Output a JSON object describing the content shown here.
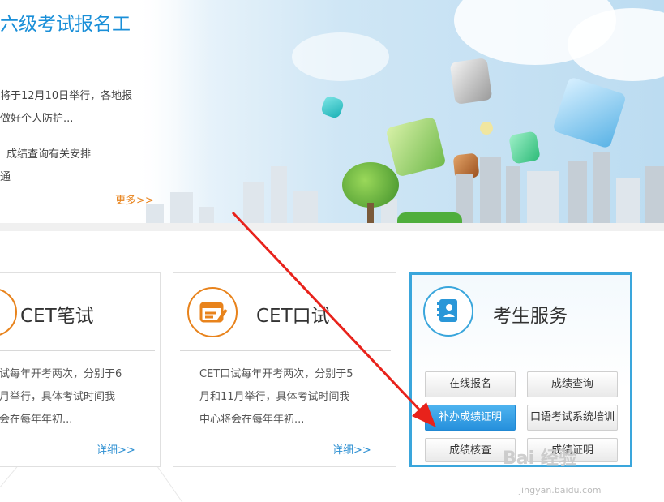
{
  "banner": {
    "title": "六级考试报名工",
    "news": [
      "将于12月10日举行，各地报",
      "做好个人防护...",
      "成绩查询有关安排",
      "通"
    ],
    "more_label": "更多>>"
  },
  "cards": [
    {
      "title": "CET笔试",
      "body": [
        "试每年开考两次，分别于6",
        "月举行，具体考试时间我",
        "会在每年年初..."
      ],
      "detail_label": "详细>>"
    },
    {
      "title": "CET口试",
      "body": [
        "CET口试每年开考两次，分别于5",
        "月和11月举行，具体考试时间我",
        "中心将会在每年年初..."
      ],
      "detail_label": "详细>>"
    }
  ],
  "services": {
    "title": "考生服务",
    "buttons": [
      "在线报名",
      "成绩查询",
      "补办成绩证明",
      "口语考试系统培训",
      "成绩核查",
      "成绩证明"
    ],
    "active_index": 2
  },
  "watermark": {
    "brand": "Bai 经验",
    "url": "jingyan.baidu.com"
  },
  "colors": {
    "accent_blue": "#1a8fd8",
    "more_orange": "#e8831c",
    "service_border": "#3aa6dc",
    "active_button": "#2690dc",
    "arrow_red": "#e8221b"
  }
}
